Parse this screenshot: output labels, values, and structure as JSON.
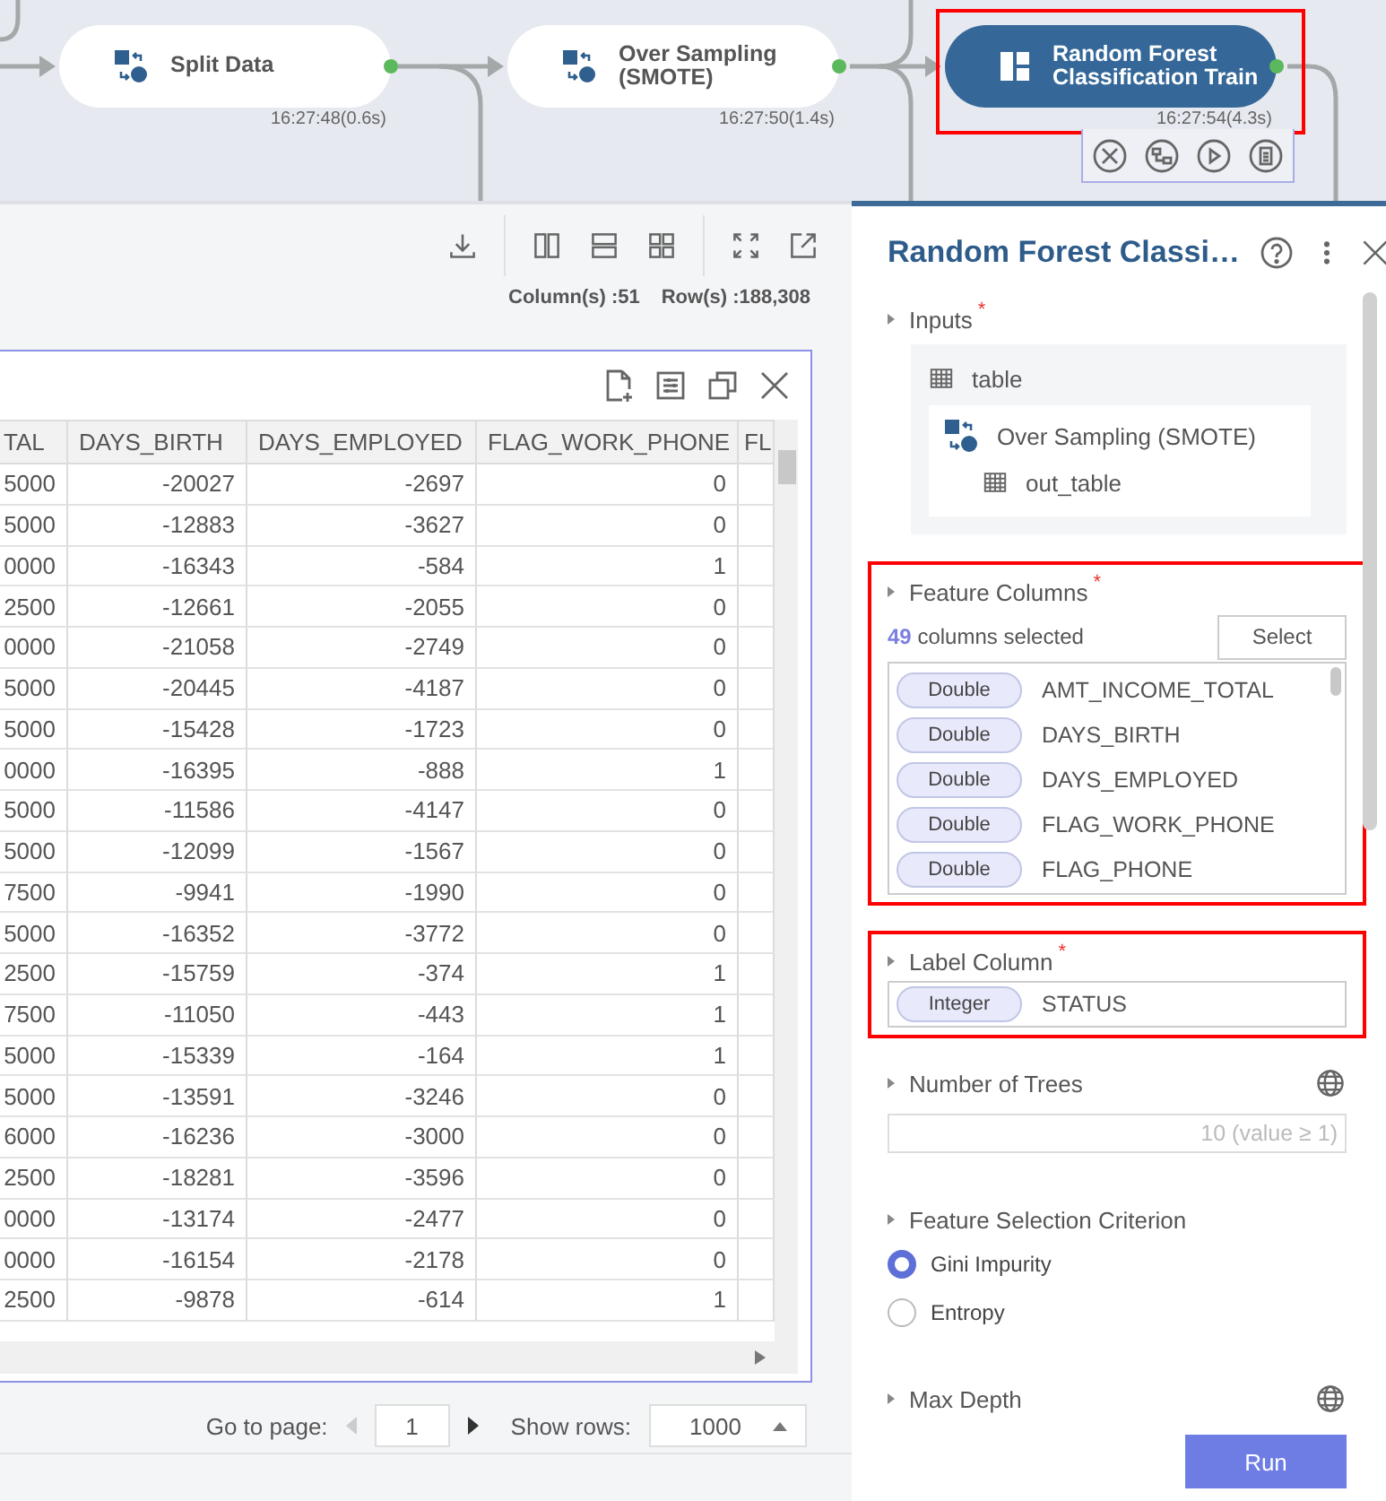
{
  "canvas": {
    "nodes": [
      {
        "kind": "split",
        "label": "Split Data",
        "time": "16:27:48(0.6s)",
        "selected": false,
        "highlighted": false
      },
      {
        "kind": "split",
        "label": "Over Sampling (SMOTE)",
        "time": "16:27:50(1.4s)",
        "selected": false,
        "highlighted": false
      },
      {
        "kind": "model",
        "label": "Random Forest Classification Train",
        "time": "16:27:54(4.3s)",
        "selected": true,
        "highlighted": true
      }
    ]
  },
  "toolbar": {
    "stats": [
      "Column(s) :51",
      "Row(s) :188,308"
    ]
  },
  "table": {
    "columns": [
      "TAL",
      "DAYS_BIRTH",
      "DAYS_EMPLOYED",
      "FLAG_WORK_PHONE",
      "FL"
    ],
    "rows": [
      [
        "5000",
        "-20027",
        "-2697",
        "0"
      ],
      [
        "5000",
        "-12883",
        "-3627",
        "0"
      ],
      [
        "0000",
        "-16343",
        "-584",
        "1"
      ],
      [
        "2500",
        "-12661",
        "-2055",
        "0"
      ],
      [
        "0000",
        "-21058",
        "-2749",
        "0"
      ],
      [
        "5000",
        "-20445",
        "-4187",
        "0"
      ],
      [
        "5000",
        "-15428",
        "-1723",
        "0"
      ],
      [
        "0000",
        "-16395",
        "-888",
        "1"
      ],
      [
        "5000",
        "-11586",
        "-4147",
        "0"
      ],
      [
        "5000",
        "-12099",
        "-1567",
        "0"
      ],
      [
        "7500",
        "-9941",
        "-1990",
        "0"
      ],
      [
        "5000",
        "-16352",
        "-3772",
        "0"
      ],
      [
        "2500",
        "-15759",
        "-374",
        "1"
      ],
      [
        "7500",
        "-11050",
        "-443",
        "1"
      ],
      [
        "5000",
        "-15339",
        "-164",
        "1"
      ],
      [
        "5000",
        "-13591",
        "-3246",
        "0"
      ],
      [
        "6000",
        "-16236",
        "-3000",
        "0"
      ],
      [
        "2500",
        "-18281",
        "-3596",
        "0"
      ],
      [
        "0000",
        "-13174",
        "-2477",
        "0"
      ],
      [
        "0000",
        "-16154",
        "-2178",
        "0"
      ],
      [
        "2500",
        "-9878",
        "-614",
        "1"
      ]
    ]
  },
  "pager": {
    "label": "Go to page:",
    "page": "1",
    "rows_label": "Show rows:",
    "rows_value": "1000"
  },
  "panel": {
    "title": "Random Forest Classi…",
    "inputs": {
      "label": "Inputs",
      "mark": "*",
      "port": "table",
      "source": "Over Sampling (SMOTE)",
      "output": "out_table"
    },
    "feature_columns": {
      "label": "Feature Columns",
      "mark": "*",
      "highlighted": true,
      "count": "49",
      "count_text": "columns selected",
      "button": "Select",
      "items": [
        {
          "type": "Double",
          "name": "AMT_INCOME_TOTAL"
        },
        {
          "type": "Double",
          "name": "DAYS_BIRTH"
        },
        {
          "type": "Double",
          "name": "DAYS_EMPLOYED"
        },
        {
          "type": "Double",
          "name": "FLAG_WORK_PHONE"
        },
        {
          "type": "Double",
          "name": "FLAG_PHONE"
        }
      ]
    },
    "label_column": {
      "label": "Label Column",
      "mark": "*",
      "highlighted": true,
      "type": "Integer",
      "name": "STATUS"
    },
    "number_of_trees": {
      "label": "Number of Trees",
      "placeholder": "10 (value ≥ 1)"
    },
    "criterion": {
      "label": "Feature Selection Criterion",
      "options": [
        {
          "label": "Gini Impurity",
          "selected": true
        },
        {
          "label": "Entropy",
          "selected": false
        }
      ]
    },
    "max_depth": {
      "label": "Max Depth"
    },
    "run": "Run"
  }
}
